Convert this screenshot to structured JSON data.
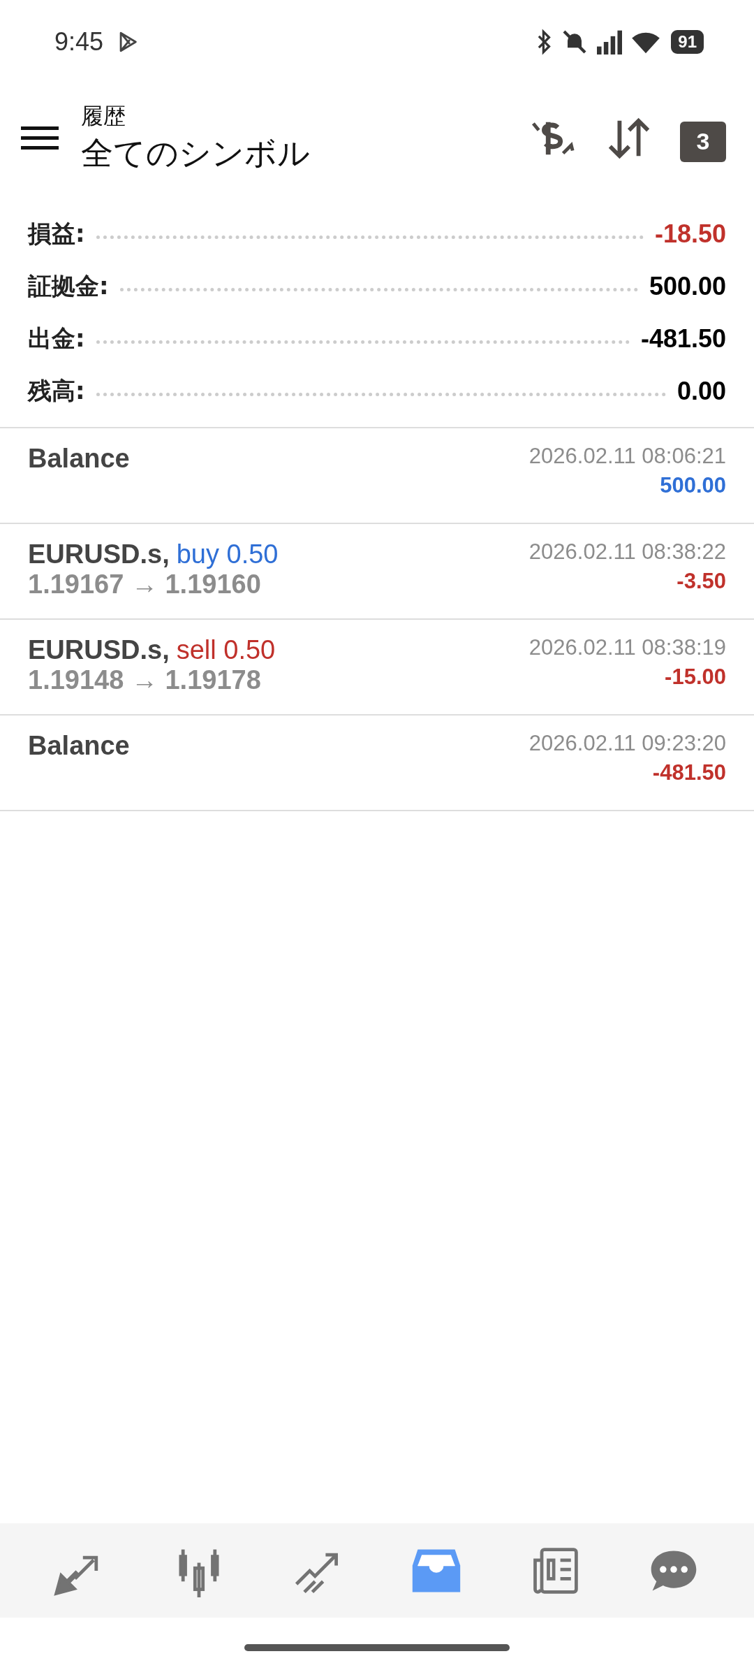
{
  "status_bar": {
    "time": "9:45",
    "battery": "91"
  },
  "header": {
    "subtitle": "履歴",
    "title": "全てのシンボル",
    "calendar_day": "3"
  },
  "summary": [
    {
      "label": "損益:",
      "value": {
        "text": "-18.50",
        "color": "#c0312b"
      }
    },
    {
      "label": "証拠金:",
      "value": {
        "text": "500.00",
        "color": "#000000"
      }
    },
    {
      "label": "出金:",
      "value": {
        "text": "-481.50",
        "color": "#000000"
      }
    },
    {
      "label": "残高:",
      "value": {
        "text": "0.00",
        "color": "#000000"
      }
    }
  ],
  "deals": [
    {
      "kind": "balance",
      "title": "Balance",
      "time": "2026.02.11 08:06:21",
      "amount": {
        "text": "500.00",
        "color": "#2f6fd6"
      }
    },
    {
      "kind": "trade",
      "symbol": "EURUSD.s,",
      "side": {
        "text": "buy 0.50",
        "color": "#2f6fd6"
      },
      "prices": "1.19167 → 1.19160",
      "time": "2026.02.11 08:38:22",
      "amount": {
        "text": "-3.50",
        "color": "#c0312b"
      }
    },
    {
      "kind": "trade",
      "symbol": "EURUSD.s,",
      "side": {
        "text": "sell 0.50",
        "color": "#c0312b"
      },
      "prices": "1.19148 → 1.19178",
      "time": "2026.02.11 08:38:19",
      "amount": {
        "text": "-15.00",
        "color": "#c0312b"
      }
    },
    {
      "kind": "balance",
      "title": "Balance",
      "time": "2026.02.11 09:23:20",
      "amount": {
        "text": "-481.50",
        "color": "#c0312b"
      }
    }
  ],
  "nav": [
    {
      "kind": "quotes",
      "selected": false
    },
    {
      "kind": "chart",
      "selected": false
    },
    {
      "kind": "trade",
      "selected": false
    },
    {
      "kind": "history",
      "selected": true
    },
    {
      "kind": "news",
      "selected": false
    },
    {
      "kind": "chat",
      "selected": false
    }
  ]
}
